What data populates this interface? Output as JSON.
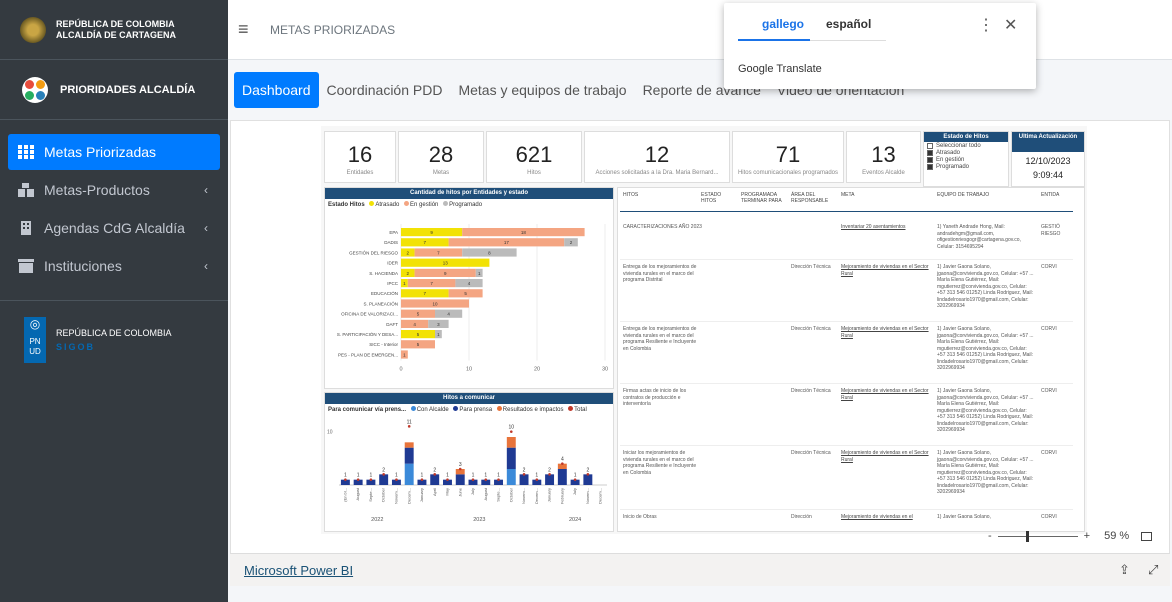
{
  "sidebar": {
    "brand_line1": "REPÚBLICA DE COLOMBIA",
    "brand_line2": "ALCALDÍA DE CARTAGENA",
    "app_name": "PRIORIDADES ALCALDÍA",
    "items": [
      {
        "label": "Metas Priorizadas",
        "active": true
      },
      {
        "label": "Metas-Productos",
        "arrow": "‹"
      },
      {
        "label": "Agendas CdG Alcaldía",
        "arrow": "‹"
      },
      {
        "label": "Instituciones",
        "arrow": "‹"
      }
    ],
    "footer_line1": "REPÚBLICA DE COLOMBIA",
    "footer_line2": "SIGOB",
    "undp": "PN UD"
  },
  "topbar": {
    "menu_icon": "≡",
    "title": "METAS PRIORIZADAS"
  },
  "tabs": [
    "Dashboard",
    "Coordinación PDD",
    "Metas y equipos de trabajo",
    "Reporte de avance",
    "Video de orientación"
  ],
  "translate": {
    "lang1": "gallego",
    "lang2": "español",
    "brand": "Google Translate",
    "more": "⋮",
    "close": "✕"
  },
  "report": {
    "kpis": [
      {
        "value": "16",
        "label": "Entidades"
      },
      {
        "value": "28",
        "label": "Metas"
      },
      {
        "value": "621",
        "label": "Hitos"
      },
      {
        "value": "12",
        "label": "Acciones solicitadas a la Dra. Maria Bernard..."
      },
      {
        "value": "71",
        "label": "Hitos comunicacionales programados"
      },
      {
        "value": "13",
        "label": "Eventos Alcalde"
      }
    ],
    "filter": {
      "title": "Estado de Hitos",
      "options": [
        {
          "label": "Seleccionar todo",
          "checked": false
        },
        {
          "label": "Atrasado",
          "checked": true
        },
        {
          "label": "En gestión",
          "checked": true
        },
        {
          "label": "Programado",
          "checked": true
        }
      ]
    },
    "update": {
      "title": "Ultima Actualización",
      "date": "12/10/2023",
      "time": "9:09:44"
    },
    "bar_panel": {
      "title": "Cantidad de hitos por Entidades y estado",
      "legend_title": "Estado Hitos",
      "legend": [
        "Atrasado",
        "En gestión",
        "Programado"
      ]
    },
    "col_panel": {
      "title": "Hitos a comunicar",
      "legend_title": "Para comunicar vía prens...",
      "legend": [
        "Con Alcalde",
        "Para prensa",
        "Resultados e impactos",
        "Total"
      ],
      "years": [
        "2022",
        "2023",
        "2024"
      ],
      "ytick": "10"
    },
    "table": {
      "headers": [
        "HITOS",
        "ESTADO HITOS",
        "PROGRAMADA TERMINAR PARA",
        "ÁREA DEL RESPONSABLE",
        "META",
        "EQUIPO DE TRABAJO",
        "ENTIDA"
      ],
      "rows": [
        {
          "hito": "CARACTERIZACIONES AÑO 2023",
          "area": "",
          "meta": "Inventariar 20 asentamientos",
          "equipo": "1) Yaneth Andrade Hong, Mail: andradehgm@gmail.com, ofigestionriesgogr@cartagena.gov.co, Celular: 3154695294",
          "ent": "GESTIÓ RIESGO"
        },
        {
          "hito": "Entrega de los mejoramientos de vivienda rurales en el marco del programa Distrital",
          "area": "Dirección Técnica",
          "meta": "Mejoramiento de viviendas en el Sector Rural",
          "equipo": "1) Javier Gaona Solano, jgaona@corvivienda.gov.co, Celular: +57 ... María Elena Gutiérrez, Mail: mgutierrez@corvivienda.gov.co, Celular: +57 313 546 01252) Linda Rodriguez, Mail: lindadelrosario1970@gmail.com, Celular: 3202969934",
          "ent": "CORVI"
        },
        {
          "hito": "Entrega de los mejoramientos de vivienda rurales en el marco del programa Resiliente e Incluyente en Colombia",
          "area": "Dirección Técnica",
          "meta": "Mejoramiento de viviendas en el Sector Rural",
          "equipo": "1) Javier Gaona Solano, jgaona@corvivienda.gov.co, Celular: +57 ... María Elena Gutiérrez, Mail: mgutierrez@corvivienda.gov.co, Celular: +57 313 546 01252) Linda Rodriguez, Mail: lindadelrosario1970@gmail.com, Celular: 3202969934",
          "ent": "CORVI"
        },
        {
          "hito": "Firmas actas de inicio de los contratos de producción e interventoría",
          "area": "Dirección Técnica",
          "meta": "Mejoramiento de viviendas en el Sector Rural",
          "equipo": "1) Javier Gaona Solano, jgaona@corvivienda.gov.co, Celular: +57 ... María Elena Gutiérrez, Mail: mgutierrez@corvivienda.gov.co, Celular: +57 313 546 01252) Linda Rodriguez, Mail: lindadelrosario1970@gmail.com, Celular: 3202969934",
          "ent": "CORVI"
        },
        {
          "hito": "Iniciar los mejoramientos de vivienda rurales en el marco del programa Resiliente e Incluyente en Colombia",
          "area": "Dirección Técnica",
          "meta": "Mejoramiento de viviendas en el Sector Rural",
          "equipo": "1) Javier Gaona Solano, jgaona@corvivienda.gov.co, Celular: +57 ... María Elena Gutiérrez, Mail: mgutierrez@corvivienda.gov.co, Celular: +57 313 546 01252) Linda Rodriguez, Mail: lindadelrosario1970@gmail.com, Celular: 3202969934",
          "ent": "CORVI"
        },
        {
          "hito": "Inicio de Obras",
          "area": "Dirección",
          "meta": "Mejoramiento de viviendas en el",
          "equipo": "1) Javier Gaona Solano,",
          "ent": "CORVI"
        }
      ]
    }
  },
  "chart_data": [
    {
      "type": "bar",
      "title": "Cantidad de hitos por Entidades y estado",
      "categories": [
        "EPA",
        "DADIS",
        "GESTIÓN DEL RIESGO",
        "IDER",
        "S. HACIENDA",
        "IPCC",
        "EDUCACIÓN",
        "S. PLANEACIÓN",
        "OFICINA DE VALORIZACI...",
        "DAFT",
        "S. PARTICIPACIÓN Y DESA...",
        "SICC - Interior",
        "PES - PLAN DE EMERGEN..."
      ],
      "series": [
        {
          "name": "Atrasado",
          "color": "#f2e205",
          "values": [
            9,
            7,
            2,
            13,
            2,
            1,
            7,
            0,
            0,
            0,
            5,
            0,
            0
          ]
        },
        {
          "name": "En gestión",
          "color": "#f4a582",
          "values": [
            18,
            17,
            7,
            0,
            9,
            7,
            5,
            10,
            5,
            4,
            0,
            5,
            1
          ]
        },
        {
          "name": "Programado",
          "color": "#bbbbbb",
          "values": [
            0,
            2,
            8,
            0,
            1,
            4,
            0,
            0,
            4,
            3,
            1,
            0,
            0
          ]
        }
      ],
      "xlim": [
        0,
        30
      ],
      "xticks": [
        0,
        10,
        20,
        30
      ]
    },
    {
      "type": "bar",
      "title": "Hitos a comunicar",
      "categories": [
        "(En bl...",
        "August",
        "Septe...",
        "October",
        "Novem...",
        "Decem...",
        "January",
        "April",
        "May",
        "June",
        "July",
        "August",
        "Septe...",
        "October",
        "Novem...",
        "Decem...",
        "January",
        "February",
        "July",
        "Novem...",
        "Decem..."
      ],
      "total_labels": [
        "1",
        "1",
        "1",
        "2",
        "1",
        "11",
        "1",
        "2",
        "1",
        "3",
        "1",
        "1",
        "1",
        "10",
        "2",
        "1",
        "2",
        "4",
        "1",
        "2",
        ""
      ],
      "series": [
        {
          "name": "Con Alcalde",
          "color": "#3b8ad9",
          "values": [
            0,
            0,
            0,
            0,
            0,
            4,
            0,
            0,
            0,
            0,
            0,
            0,
            0,
            3,
            0,
            0,
            0,
            0,
            0,
            0,
            0
          ]
        },
        {
          "name": "Para prensa",
          "color": "#1f3a93",
          "values": [
            1,
            1,
            1,
            2,
            1,
            3,
            1,
            2,
            1,
            2,
            1,
            1,
            1,
            4,
            2,
            1,
            2,
            3,
            1,
            2,
            0
          ]
        },
        {
          "name": "Resultados e impactos",
          "color": "#e8743b",
          "values": [
            0,
            0,
            0,
            0,
            0,
            1,
            0,
            0,
            0,
            1,
            0,
            0,
            0,
            2,
            0,
            0,
            0,
            1,
            0,
            0,
            0
          ]
        },
        {
          "name": "Total",
          "color": "#c0392b",
          "values": [
            1,
            1,
            1,
            2,
            1,
            11,
            1,
            2,
            1,
            3,
            1,
            1,
            1,
            10,
            2,
            1,
            2,
            4,
            1,
            2,
            0
          ]
        }
      ],
      "ylim": [
        0,
        12
      ]
    }
  ],
  "footer": {
    "link": "Microsoft Power BI",
    "zoom": "59 %"
  }
}
